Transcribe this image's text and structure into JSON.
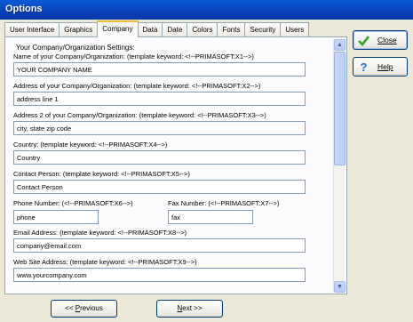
{
  "window": {
    "title": "Options"
  },
  "tabs": [
    {
      "label": "User Interface"
    },
    {
      "label": "Graphics"
    },
    {
      "label": "Company",
      "active": true
    },
    {
      "label": "Data"
    },
    {
      "label": "Date"
    },
    {
      "label": "Colors"
    },
    {
      "label": "Fonts"
    },
    {
      "label": "Security"
    },
    {
      "label": "Users"
    }
  ],
  "company": {
    "group_title": "Your Company/Organization Settings:",
    "name_label": "Name of your Company/Organization:  (template keyword: <!--PRIMASOFT:X1-->)",
    "name_value": "YOUR COMPANY NAME",
    "address_label": "Address of your Company/Organization:  (template keyword: <!--PRIMASOFT:X2-->)",
    "address_value": "address line 1",
    "address2_label": "Address 2 of your Company/Organization:  (template keyword: <!--PRIMASOFT:X3-->)",
    "address2_value": "city,  state  zip code",
    "country_label": "Country:  (template keyword: <!--PRIMASOFT:X4-->)",
    "country_value": "Country",
    "contact_label": "Contact Person:  (template keyword: <!--PRIMASOFT:X5-->)",
    "contact_value": "Contact Person",
    "phone_label": "Phone Number:  (<!--PRIMASOFT:X6-->)",
    "phone_value": "phone",
    "fax_label": "Fax Number:  (<!--PRIMASOFT:X7-->)",
    "fax_value": "fax",
    "email_label": "Email Address:  (template keyword: <!--PRIMASOFT:X8-->)",
    "email_value": "company@email.com",
    "web_label": "Web Site Address:  (template keyword: <!--PRIMASOFT:X9-->)",
    "web_value": "www.yourcompany.com"
  },
  "buttons": {
    "close": {
      "label": "Close",
      "icon": "check-icon"
    },
    "help": {
      "label": "Help",
      "icon": "question-icon"
    },
    "previous_a": "<< ",
    "previous_u": "P",
    "previous_b": "revious",
    "next_u": "N",
    "next_b": "ext >>"
  },
  "colors": {
    "title_bar": "#0a5bd8",
    "active_tab_accent": "#f3b93a",
    "check": "#2aa52a",
    "help": "#1f6fd1"
  }
}
